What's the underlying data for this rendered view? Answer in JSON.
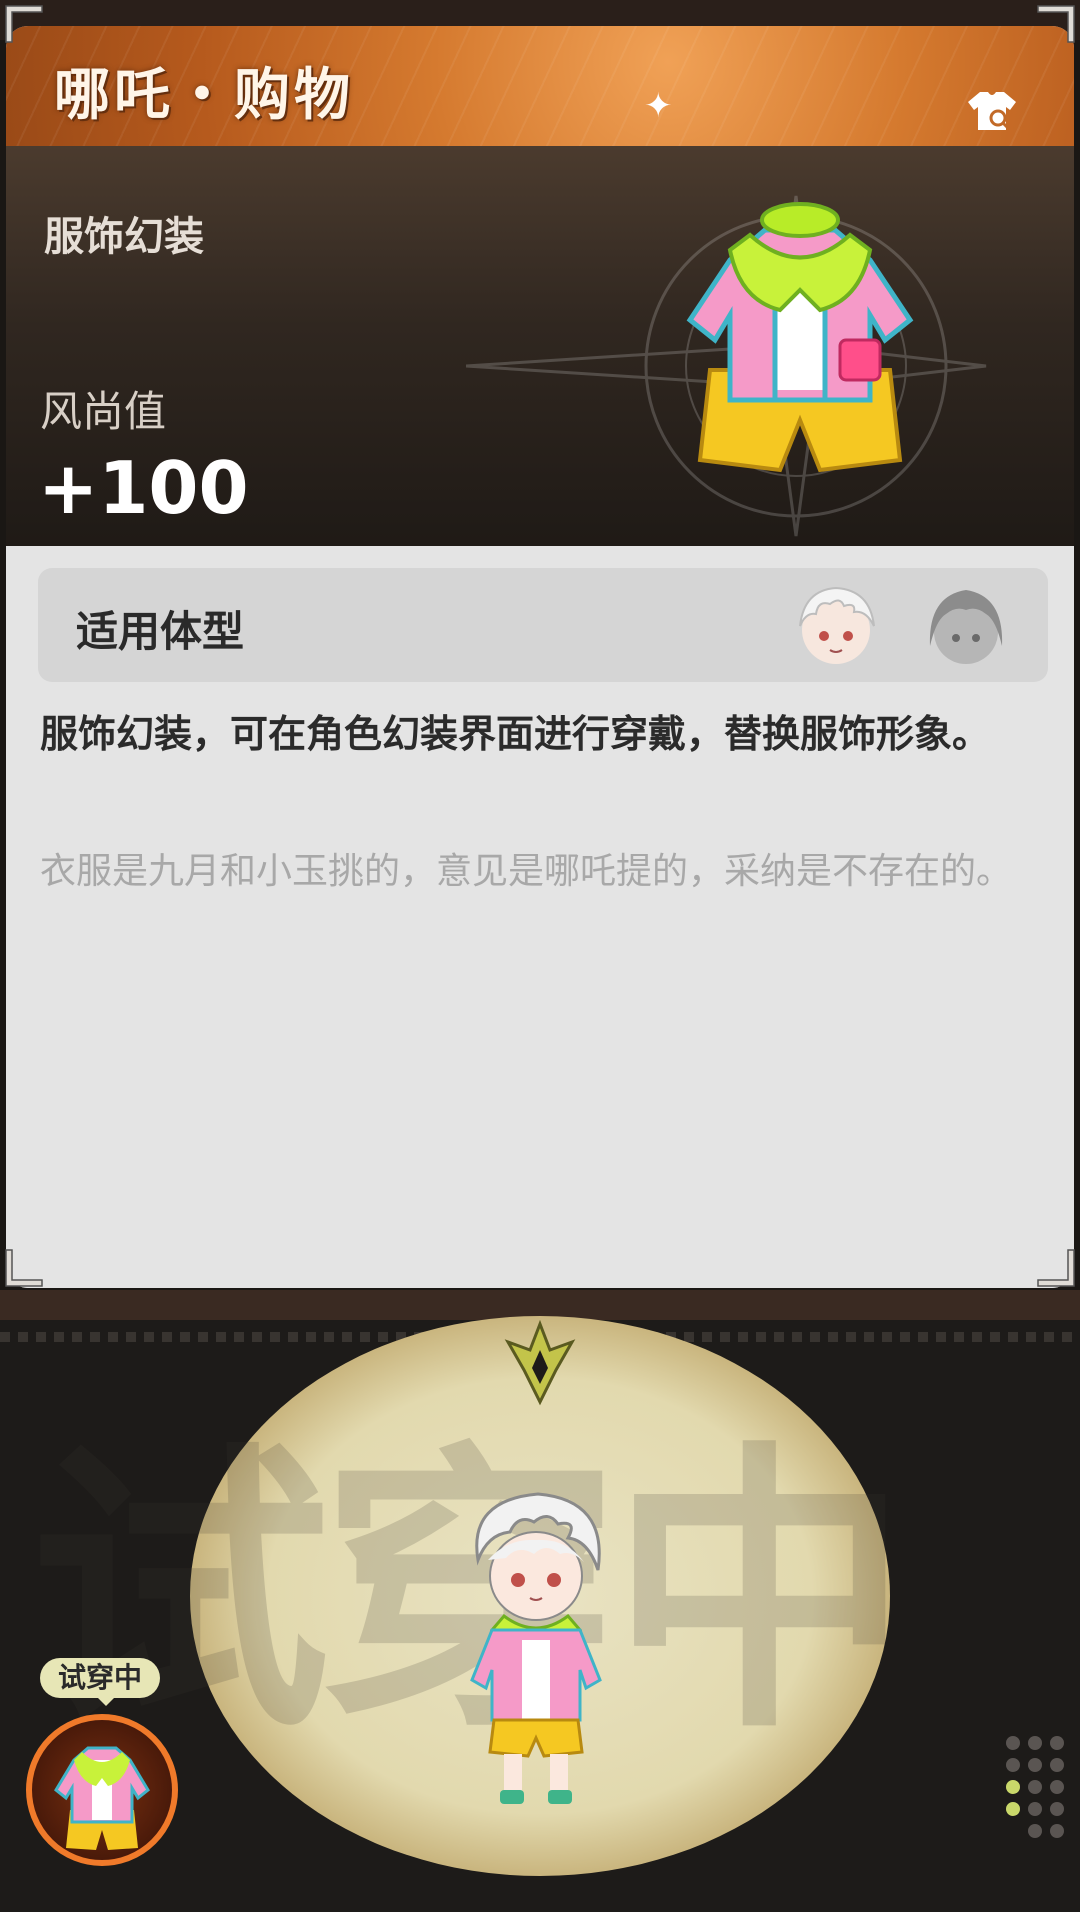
{
  "header": {
    "title": "哪吒・购物",
    "shop_icon": "shirt-search-icon"
  },
  "item": {
    "category": "服饰幻装",
    "style_label": "风尚值",
    "style_value": "+100"
  },
  "body_type": {
    "label": "适用体型",
    "avatars": [
      "avatar-boy-selected",
      "avatar-girl-unselected"
    ]
  },
  "description": {
    "main": "服饰幻装，可在角色幻装界面进行穿戴，替换服饰形象。",
    "flavor": "衣服是九月和小玉挑的，意见是哪吒提的，采纳是不存在的。"
  },
  "stage": {
    "watermark": "试穿中",
    "badge": "试穿中"
  },
  "colors": {
    "accent_orange": "#e07c2c",
    "badge_bg": "#e7e6b6",
    "dot_active": "#c9d86a"
  }
}
